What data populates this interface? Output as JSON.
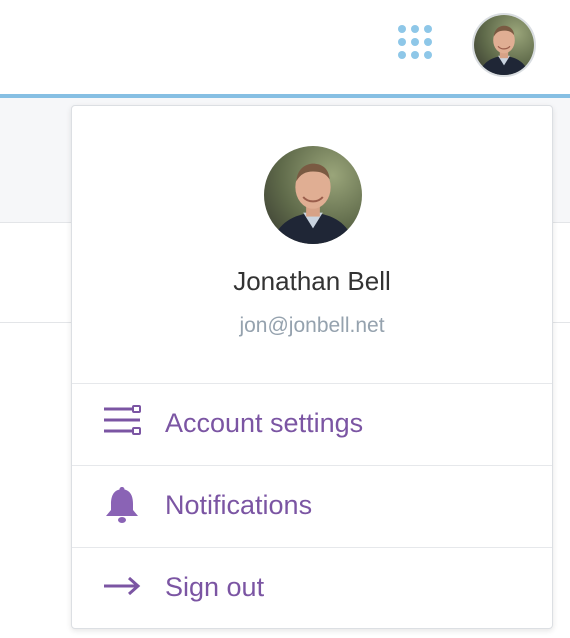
{
  "header": {
    "apps_icon": "grid-dots-icon",
    "avatar_alt": "Jonathan Bell avatar"
  },
  "colors": {
    "accent_line": "#86bfe3",
    "apps_icon": "#8ec7e8",
    "menu_text": "#7b55a3",
    "email_text": "#95a2ae",
    "name_text": "#333333"
  },
  "dropdown": {
    "user": {
      "name": "Jonathan Bell",
      "email": "jon@jonbell.net"
    },
    "menu": [
      {
        "label": "Account settings",
        "icon": "sliders-icon"
      },
      {
        "label": "Notifications",
        "icon": "bell-icon"
      },
      {
        "label": "Sign out",
        "icon": "arrow-right-icon"
      }
    ]
  }
}
